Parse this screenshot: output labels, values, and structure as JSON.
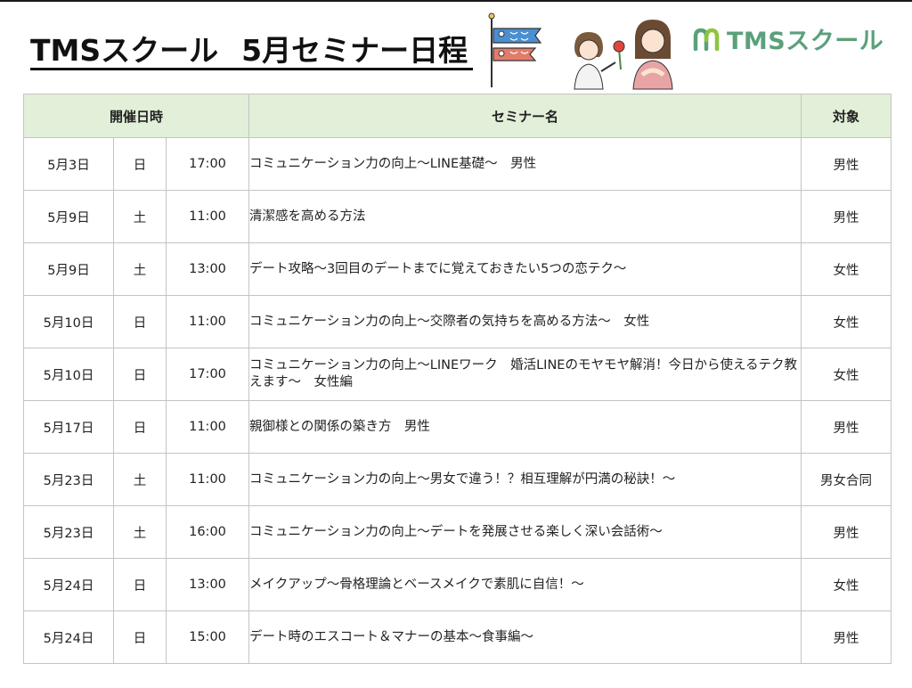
{
  "title": {
    "part1": "TMSスクール",
    "part2": "5月セミナー日程"
  },
  "logo": {
    "text": "TMSスクール",
    "icon": "m-leaf-icon",
    "color": "#5aa17b"
  },
  "illustrations": [
    "koinobori-icon",
    "girl-giving-carnation-icon",
    "mother-icon"
  ],
  "colors": {
    "header_bg": "#e2efd9",
    "border": "#c4c4c4",
    "brand_green": "#5aa17b"
  },
  "table": {
    "headers": {
      "datetime": "開催日時",
      "seminar": "セミナー名",
      "target": "対象"
    },
    "rows": [
      {
        "date": "5月3日",
        "day": "日",
        "time": "17:00",
        "name": "コミュニケーション力の向上～LINE基礎～　男性",
        "target": "男性"
      },
      {
        "date": "5月9日",
        "day": "土",
        "time": "11:00",
        "name": "清潔感を高める方法",
        "target": "男性"
      },
      {
        "date": "5月9日",
        "day": "土",
        "time": "13:00",
        "name": "デート攻略～3回目のデートまでに覚えておきたい5つの恋テク～",
        "target": "女性"
      },
      {
        "date": "5月10日",
        "day": "日",
        "time": "11:00",
        "name": "コミュニケーション力の向上～交際者の気持ちを高める方法～　女性",
        "target": "女性"
      },
      {
        "date": "5月10日",
        "day": "日",
        "time": "17:00",
        "name": "コミュニケーション力の向上～LINEワーク　婚活LINEのモヤモヤ解消！今日から使えるテク教えます～　女性編",
        "target": "女性"
      },
      {
        "date": "5月17日",
        "day": "日",
        "time": "11:00",
        "name": "親御様との関係の築き方　男性",
        "target": "男性"
      },
      {
        "date": "5月23日",
        "day": "土",
        "time": "11:00",
        "name": "コミュニケーション力の向上～男女で違う！？相互理解が円満の秘訣！～",
        "target": "男女合同"
      },
      {
        "date": "5月23日",
        "day": "土",
        "time": "16:00",
        "name": "コミュニケーション力の向上～デートを発展させる楽しく深い会話術～",
        "target": "男性"
      },
      {
        "date": "5月24日",
        "day": "日",
        "time": "13:00",
        "name": "メイクアップ～骨格理論とベースメイクで素肌に自信！～",
        "target": "女性"
      },
      {
        "date": "5月24日",
        "day": "日",
        "time": "15:00",
        "name": "デート時のエスコート＆マナーの基本～食事編～",
        "target": "男性"
      }
    ]
  }
}
